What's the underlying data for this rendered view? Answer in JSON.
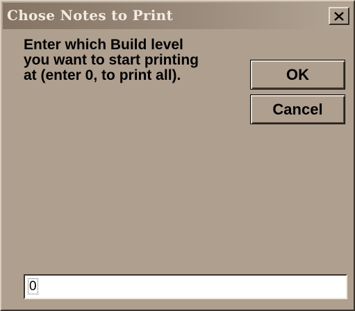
{
  "window": {
    "title": "Chose Notes to Print",
    "close_icon": "close-icon"
  },
  "prompt": {
    "lines": [
      "Enter which Build level",
      "you want to start printing",
      "at (enter 0, to print all)."
    ]
  },
  "buttons": {
    "ok_label": "OK",
    "cancel_label": "Cancel"
  },
  "input": {
    "value": "0"
  },
  "colors": {
    "dialog_background": "#ae9f8f",
    "title_bar_start": "#857463",
    "title_bar_end": "#b3a596",
    "title_text": "#f2ebe2"
  }
}
